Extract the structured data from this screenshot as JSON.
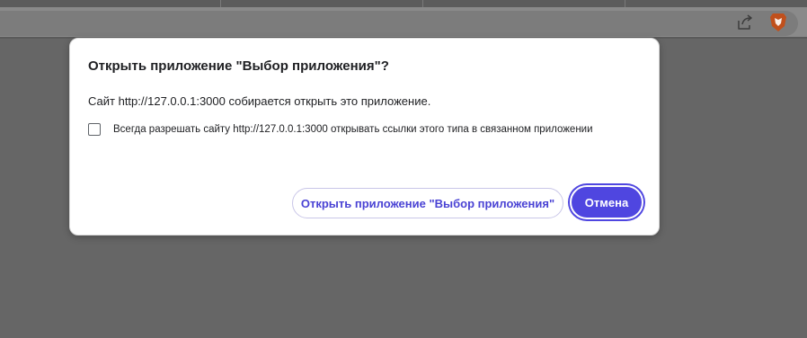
{
  "browser": {
    "toolbar_icons": [
      "share-icon",
      "brave-shields-icon"
    ],
    "colors": {
      "overlay_background": "#666666",
      "toolbar": "#8a8a8a"
    }
  },
  "dialog": {
    "title": "Открыть приложение \"Выбор приложения\"?",
    "message": "Сайт http://127.0.0.1:3000 собирается открыть это приложение.",
    "checkbox": {
      "label": "Всегда разрешать сайту http://127.0.0.1:3000 открывать ссылки этого типа в связанном приложении",
      "checked": false
    },
    "buttons": {
      "open_label": "Открыть приложение \"Выбор приложения\"",
      "cancel_label": "Отмена"
    },
    "colors": {
      "accent": "#4f46e0",
      "accent_text": "#4a43d4",
      "background": "#ffffff",
      "text": "#202124"
    }
  }
}
